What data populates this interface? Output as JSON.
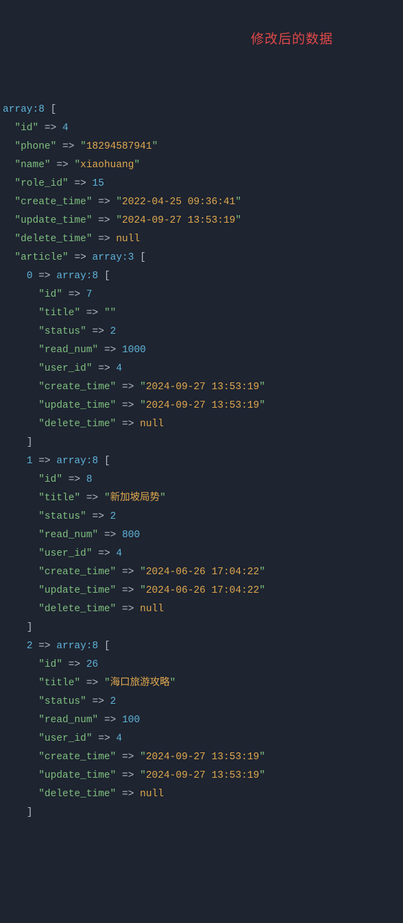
{
  "annotation": "修改后的数据",
  "root": {
    "type": "array",
    "size": 8,
    "entries": [
      {
        "key": "id",
        "kind": "num",
        "val": "4"
      },
      {
        "key": "phone",
        "kind": "str",
        "val": "18294587941"
      },
      {
        "key": "name",
        "kind": "str",
        "val": "xiaohuang"
      },
      {
        "key": "role_id",
        "kind": "num",
        "val": "15"
      },
      {
        "key": "create_time",
        "kind": "str",
        "val": "2022-04-25 09:36:41"
      },
      {
        "key": "update_time",
        "kind": "str",
        "val": "2024-09-27 13:53:19"
      },
      {
        "key": "delete_time",
        "kind": "const",
        "val": "null"
      },
      {
        "key": "article",
        "kind": "array",
        "size": 3,
        "children": [
          {
            "idx": 0,
            "size": 8,
            "entries": [
              {
                "key": "id",
                "kind": "num",
                "val": "7"
              },
              {
                "key": "title",
                "kind": "str",
                "val": ""
              },
              {
                "key": "status",
                "kind": "num",
                "val": "2"
              },
              {
                "key": "read_num",
                "kind": "num",
                "val": "1000"
              },
              {
                "key": "user_id",
                "kind": "num",
                "val": "4"
              },
              {
                "key": "create_time",
                "kind": "str",
                "val": "2024-09-27 13:53:19"
              },
              {
                "key": "update_time",
                "kind": "str",
                "val": "2024-09-27 13:53:19"
              },
              {
                "key": "delete_time",
                "kind": "const",
                "val": "null"
              }
            ]
          },
          {
            "idx": 1,
            "size": 8,
            "entries": [
              {
                "key": "id",
                "kind": "num",
                "val": "8"
              },
              {
                "key": "title",
                "kind": "str",
                "val": "新加坡局势"
              },
              {
                "key": "status",
                "kind": "num",
                "val": "2"
              },
              {
                "key": "read_num",
                "kind": "num",
                "val": "800"
              },
              {
                "key": "user_id",
                "kind": "num",
                "val": "4"
              },
              {
                "key": "create_time",
                "kind": "str",
                "val": "2024-06-26 17:04:22"
              },
              {
                "key": "update_time",
                "kind": "str",
                "val": "2024-06-26 17:04:22"
              },
              {
                "key": "delete_time",
                "kind": "const",
                "val": "null"
              }
            ]
          },
          {
            "idx": 2,
            "size": 8,
            "entries": [
              {
                "key": "id",
                "kind": "num",
                "val": "26"
              },
              {
                "key": "title",
                "kind": "str",
                "val": "海口旅游攻略"
              },
              {
                "key": "status",
                "kind": "num",
                "val": "2"
              },
              {
                "key": "read_num",
                "kind": "num",
                "val": "100"
              },
              {
                "key": "user_id",
                "kind": "num",
                "val": "4"
              },
              {
                "key": "create_time",
                "kind": "str",
                "val": "2024-09-27 13:53:19"
              },
              {
                "key": "update_time",
                "kind": "str",
                "val": "2024-09-27 13:53:19"
              },
              {
                "key": "delete_time",
                "kind": "const",
                "val": "null"
              }
            ]
          }
        ]
      }
    ]
  }
}
